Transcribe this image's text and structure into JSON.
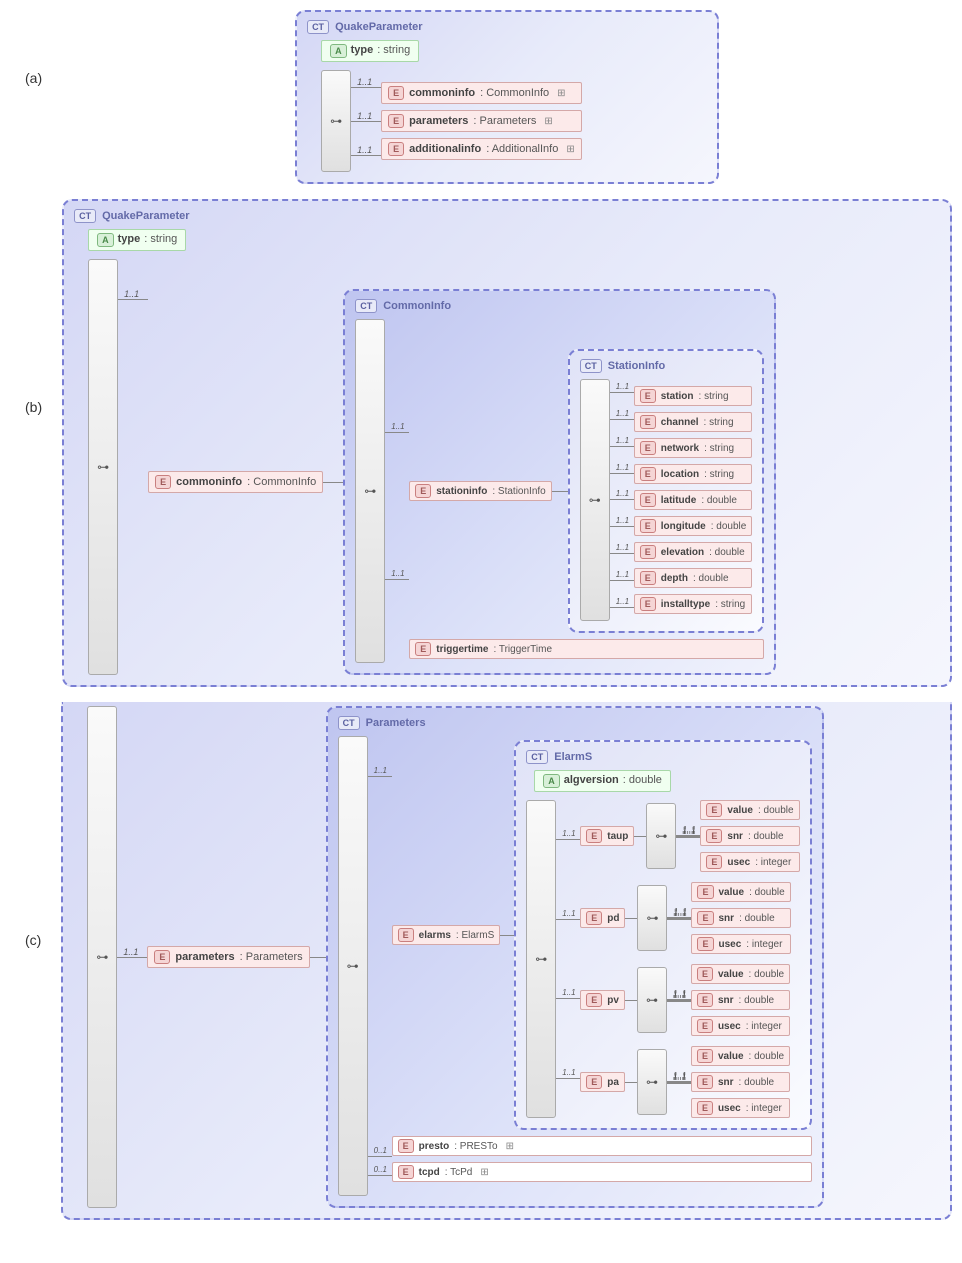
{
  "labels": {
    "a": "(a)",
    "b": "(b)",
    "c": "(c)"
  },
  "tags": {
    "ct": "CT",
    "a": "A",
    "e": "E"
  },
  "card": {
    "one": "1..1",
    "zeroOne": "0..1"
  },
  "panelA": {
    "title": "QuakeParameter",
    "attr": {
      "name": "type",
      "typ": ": string"
    },
    "items": [
      {
        "name": "commoninfo",
        "typ": ": CommonInfo"
      },
      {
        "name": "parameters",
        "typ": ": Parameters"
      },
      {
        "name": "additionalinfo",
        "typ": ": AdditionalInfo"
      }
    ]
  },
  "panelB": {
    "title": "QuakeParameter",
    "attr": {
      "name": "type",
      "typ": ": string"
    },
    "commoninfo": {
      "name": "commoninfo",
      "typ": ": CommonInfo"
    },
    "ciBox": {
      "title": "CommonInfo"
    },
    "stationinfo": {
      "name": "stationinfo",
      "typ": ": StationInfo"
    },
    "triggertime": {
      "name": "triggertime",
      "typ": ": TriggerTime"
    },
    "siBox": {
      "title": "StationInfo"
    },
    "siItems": [
      {
        "name": "station",
        "typ": ": string"
      },
      {
        "name": "channel",
        "typ": ": string"
      },
      {
        "name": "network",
        "typ": ": string"
      },
      {
        "name": "location",
        "typ": ": string"
      },
      {
        "name": "latitude",
        "typ": ": double"
      },
      {
        "name": "longitude",
        "typ": ": double"
      },
      {
        "name": "elevation",
        "typ": ": double"
      },
      {
        "name": "depth",
        "typ": ": double"
      },
      {
        "name": "installtype",
        "typ": ": string"
      }
    ]
  },
  "panelC": {
    "parameters": {
      "name": "parameters",
      "typ": ": Parameters"
    },
    "paramBox": {
      "title": "Parameters"
    },
    "paramItems": [
      {
        "name": "elarms",
        "typ": ": ElarmS",
        "card": "1..1"
      },
      {
        "name": "presto",
        "typ": ": PRESTo",
        "card": "0..1"
      },
      {
        "name": "tcpd",
        "typ": ": TcPd",
        "card": "0..1"
      }
    ],
    "elarmsBox": {
      "title": "ElarmS",
      "attr": {
        "name": "algversion",
        "typ": ": double"
      }
    },
    "elarmsGroups": [
      "taup",
      "pd",
      "pv",
      "pa"
    ],
    "metric": [
      {
        "name": "value",
        "typ": ": double"
      },
      {
        "name": "snr",
        "typ": ": double"
      },
      {
        "name": "usec",
        "typ": ": integer"
      }
    ]
  }
}
